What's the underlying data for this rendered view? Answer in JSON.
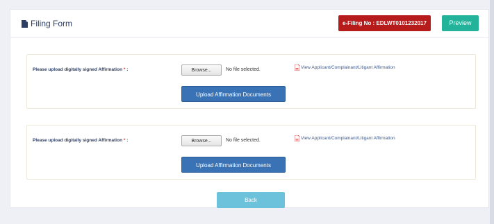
{
  "header": {
    "title": "Filing Form",
    "efiling_badge": "e-Filing No : EDLWT0101232017",
    "preview_label": "Preview"
  },
  "uploads": [
    {
      "label": "Please upload digitally signed Affirmation",
      "required_mark": "*",
      "label_suffix": " :",
      "browse_label": "Browse...",
      "file_status": "No file selected.",
      "view_link": "View Applicant/Complainant/Litigant Affirmation",
      "upload_button": "Upload Affirmation Documents"
    },
    {
      "label": "Please upload digitally signed Affirmation",
      "required_mark": "*",
      "label_suffix": " :",
      "browse_label": "Browse...",
      "file_status": "No file selected.",
      "view_link": "View Applicant/Complainant/Litigant Affirmation",
      "upload_button": "Upload Affirmation Documents"
    }
  ],
  "back_label": "Back",
  "icons": {
    "title_icon": "file-icon",
    "view_icon": "pdf-icon"
  },
  "colors": {
    "badge": "#b71c1c",
    "preview": "#23b39a",
    "upload": "#3a73b5",
    "back": "#6bc2da"
  }
}
